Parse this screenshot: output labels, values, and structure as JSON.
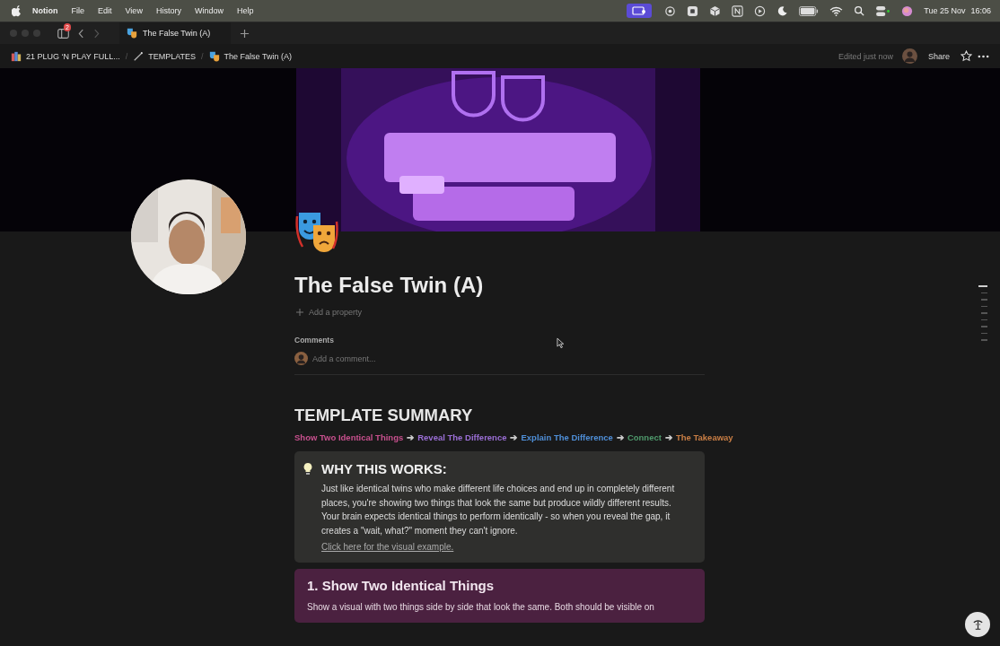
{
  "menu_bar": {
    "app": "Notion",
    "items": [
      "File",
      "Edit",
      "View",
      "History",
      "Window",
      "Help"
    ],
    "date": "Tue 25 Nov",
    "time": "16:06"
  },
  "tab_bar": {
    "badge": "2",
    "tabs": [
      {
        "title": "The False Twin (A)",
        "selected": true
      }
    ]
  },
  "breadcrumbs": {
    "separator": "/",
    "items": [
      "21 PLUG ‘N PLAY FULL...",
      "TEMPLATES",
      "The False Twin (A)"
    ]
  },
  "top_actions": {
    "edited": "Edited just now",
    "share": "Share"
  },
  "page": {
    "title": "The False Twin (A)",
    "add_property": "Add a property",
    "comments_label": "Comments",
    "comment_placeholder": "Add a comment..."
  },
  "summary": {
    "heading": "TEMPLATE SUMMARY",
    "separator": "➔",
    "steps": [
      {
        "label": "Show Two Identical Things",
        "color": "#c8508e"
      },
      {
        "label": "Reveal The Difference",
        "color": "#9b6fd6"
      },
      {
        "label": "Explain The Difference",
        "color": "#4f8fd8"
      },
      {
        "label": "Connect",
        "color": "#4f9a6c"
      },
      {
        "label": "The Takeaway",
        "color": "#c97e45"
      }
    ]
  },
  "callout": {
    "heading": "WHY THIS WORKS:",
    "body": "Just like identical twins who make different life choices and end up in completely different places, you're showing two things that look the same but produce wildly different results. Your brain expects identical things to perform identically - so when you reveal the gap, it creates a \"wait, what?\" moment they can't ignore.",
    "link": "Click here for the visual example."
  },
  "section": {
    "heading": "1. Show Two Identical Things",
    "text": "Show a visual with two things side by side that look the same. Both should be visible on"
  },
  "outline": [
    {
      "selected": true
    },
    {
      "selected": false
    },
    {
      "selected": false
    },
    {
      "selected": false
    },
    {
      "selected": false
    },
    {
      "selected": false
    },
    {
      "selected": false
    },
    {
      "selected": false
    },
    {
      "selected": false
    }
  ]
}
